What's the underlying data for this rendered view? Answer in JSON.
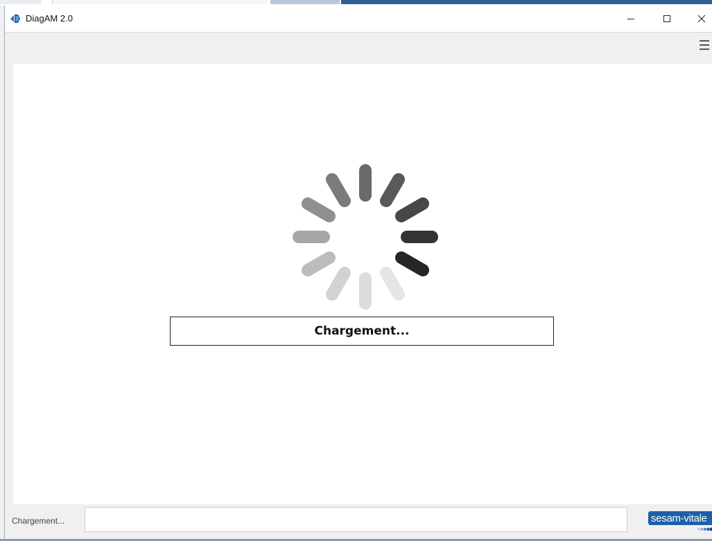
{
  "window": {
    "title": "DiagAM 2.0"
  },
  "titlebar_buttons": {
    "minimize_icon": "minimize-icon",
    "maximize_icon": "maximize-icon",
    "close_icon": "close-icon"
  },
  "menu": {
    "icon": "hamburger-menu-icon"
  },
  "loading": {
    "message": "Chargement...",
    "spinner_icon": "spinner-icon"
  },
  "statusbar": {
    "label": "Chargement...",
    "field_value": "",
    "logo_text": "sesam-vitale"
  },
  "colors": {
    "logo_blue": "#1d5fa8",
    "spinner_dark": "#333333",
    "spinner_light": "#e6e6e6"
  }
}
